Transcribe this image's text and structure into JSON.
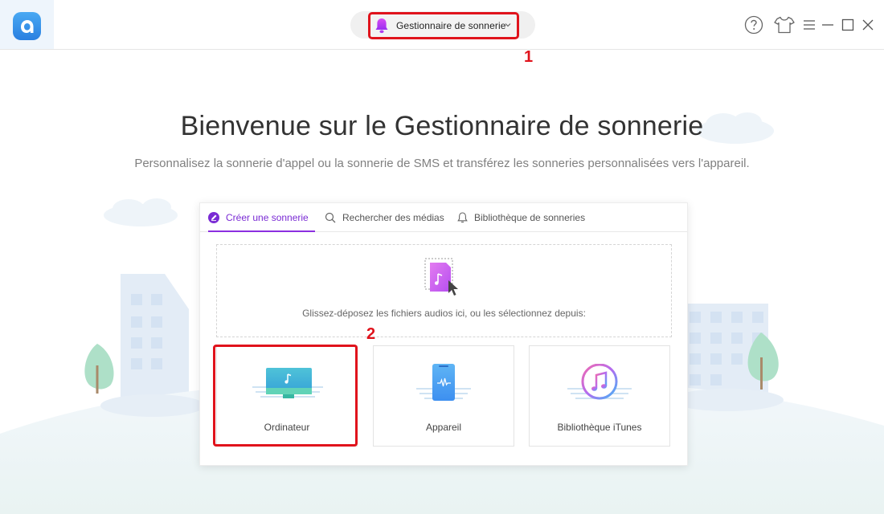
{
  "header": {
    "module_label": "Gestionnaire de sonnerie",
    "annotation_1": "1",
    "annotation_2": "2"
  },
  "window_controls": [
    "help-icon",
    "skin-icon",
    "menu-icon",
    "minimize-icon",
    "maximize-icon",
    "close-icon"
  ],
  "hero": {
    "title": "Bienvenue sur le Gestionnaire de sonnerie",
    "subtitle": "Personnalisez la sonnerie d'appel ou la sonnerie de SMS et transférez les sonneries personnalisées vers l'appareil."
  },
  "tabs": [
    {
      "label": "Créer une sonnerie",
      "icon": "edit-icon",
      "active": true
    },
    {
      "label": "Rechercher des médias",
      "icon": "search-icon",
      "active": false
    },
    {
      "label": "Bibliothèque de sonneries",
      "icon": "bell-icon",
      "active": false
    }
  ],
  "dropzone": {
    "text": "Glissez-déposez les fichiers audios ici, ou les sélectionnez depuis:"
  },
  "sources": [
    {
      "label": "Ordinateur",
      "icon": "computer-icon"
    },
    {
      "label": "Appareil",
      "icon": "phone-icon"
    },
    {
      "label": "Bibliothèque iTunes",
      "icon": "itunes-icon"
    }
  ],
  "colors": {
    "accent": "#8b2fe0",
    "annotation": "#e0131c",
    "logo": "#2a7fe0"
  }
}
